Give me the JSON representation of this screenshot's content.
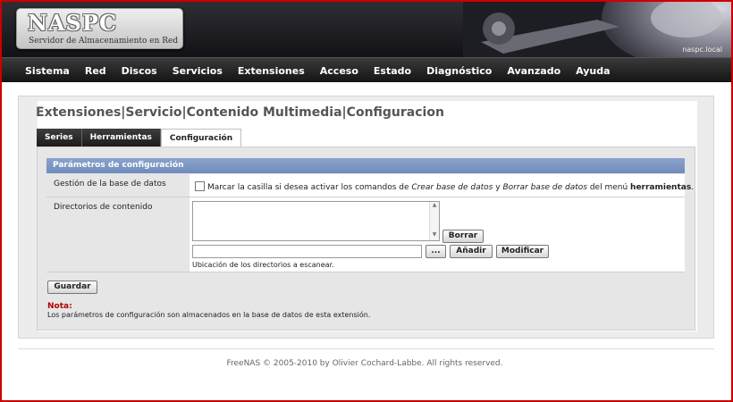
{
  "header": {
    "logo_title": "NASPC",
    "logo_subtitle": "Servidor de Almacenamiento en Red",
    "hostname": "naspc.local"
  },
  "nav": [
    "Sistema",
    "Red",
    "Discos",
    "Servicios",
    "Extensiones",
    "Acceso",
    "Estado",
    "Diagnóstico",
    "Avanzado",
    "Ayuda"
  ],
  "breadcrumb": {
    "part1": "Extensiones",
    "sep": "|",
    "part2": "Servicio",
    "part3": "Contenido Multimedia",
    "part4": "Configuracion"
  },
  "tabs": [
    {
      "label": "Series",
      "active": false
    },
    {
      "label": "Herramientas",
      "active": false
    },
    {
      "label": "Configuración",
      "active": true
    }
  ],
  "section": {
    "title": "Parámetros de configuración",
    "db_label": "Gestión de la base de datos",
    "db_checkbox_prefix": "Marcar la casilla si desea activar los comandos de ",
    "db_cmd1": "Crear base de datos",
    "db_mid": " y ",
    "db_cmd2": "Borrar base de datos",
    "db_suffix": " del menú ",
    "db_menu": "herramientas",
    "db_end": ".",
    "db_checked": false,
    "dirs_label": "Directorios de contenido",
    "dir_input_value": "",
    "dir_hint": "Ubicación de los directorios a escanear.",
    "browse_label": "...",
    "add_label": "Añadir",
    "modify_label": "Modificar",
    "delete_label": "Borrar"
  },
  "save_label": "Guardar",
  "note": {
    "label": "Nota:",
    "text": "Los parámetros de configuración son almacenados en la base de datos de esta extensión."
  },
  "footer": "FreeNAS © 2005-2010 by Olivier Cochard-Labbe. All rights reserved.",
  "colors": {
    "section_header": "#7a93c2",
    "note_label": "#b00000",
    "frame": "#cc0000"
  }
}
